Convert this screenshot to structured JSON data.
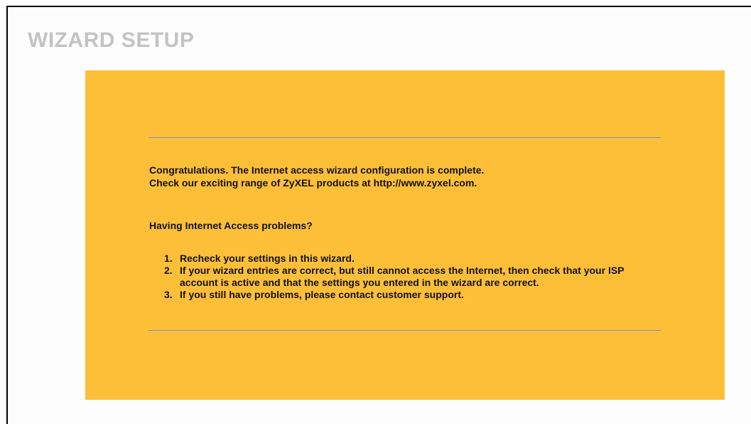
{
  "header": {
    "title": "WIZARD SETUP"
  },
  "panel": {
    "background_color": "#fdbf38",
    "congrats_line_1": "Congratulations. The Internet access wizard configuration is complete.",
    "congrats_line_2": "Check our exciting range of ZyXEL products at http://www.zyxel.com.",
    "problems_heading": "Having Internet Access problems?",
    "steps": [
      {
        "number": "1.",
        "text": "Recheck your settings in this wizard."
      },
      {
        "number": "2.",
        "text": "If your wizard entries are correct, but still cannot access the Internet, then check that your ISP account is active and that the settings you entered in the wizard are correct."
      },
      {
        "number": "3.",
        "text": "If you still have problems, please contact customer support."
      }
    ]
  }
}
